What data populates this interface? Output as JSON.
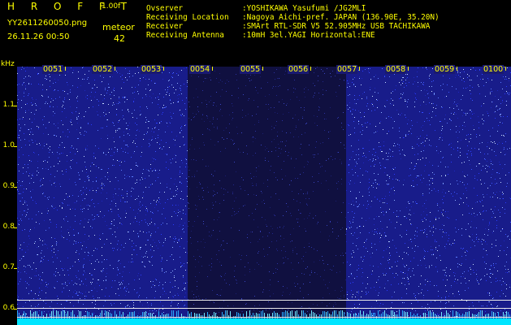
{
  "header": {
    "app_title": "H R O F F T",
    "version": "1.00f",
    "filename": "YY2611260050.png",
    "timestamp": "26.11.26 00:50",
    "meteor_label": "meteor",
    "meteor_count": "42"
  },
  "info": [
    {
      "key": "Ovserver",
      "value": ":YOSHIKAWA Yasufumi /JG2MLI"
    },
    {
      "key": "Receiving Location",
      "value": ":Nagoya Aichi-pref. JAPAN (136.90E, 35.20N)"
    },
    {
      "key": "Receiver",
      "value": ":SMArt RTL-SDR V5 52.905MHz USB TACHIKAWA"
    },
    {
      "key": "Receiving Antenna",
      "value": ":10mH 3el.YAGI Horizontal:ENE"
    }
  ],
  "y_axis": {
    "unit": "kHz",
    "ticks": [
      "1.1",
      "1.0",
      "0.9",
      "0.8",
      "0.7",
      "0.6"
    ]
  },
  "x_axis": {
    "ticks": [
      "0051",
      "0052",
      "0053",
      "0054",
      "0055",
      "0056",
      "0057",
      "0058",
      "0059",
      "0100"
    ]
  },
  "colors": {
    "background": "#000000",
    "text": "#ffff00",
    "noise_bright": "#2020b8",
    "noise_dark": "#101040",
    "signal": "#00e5ff"
  }
}
